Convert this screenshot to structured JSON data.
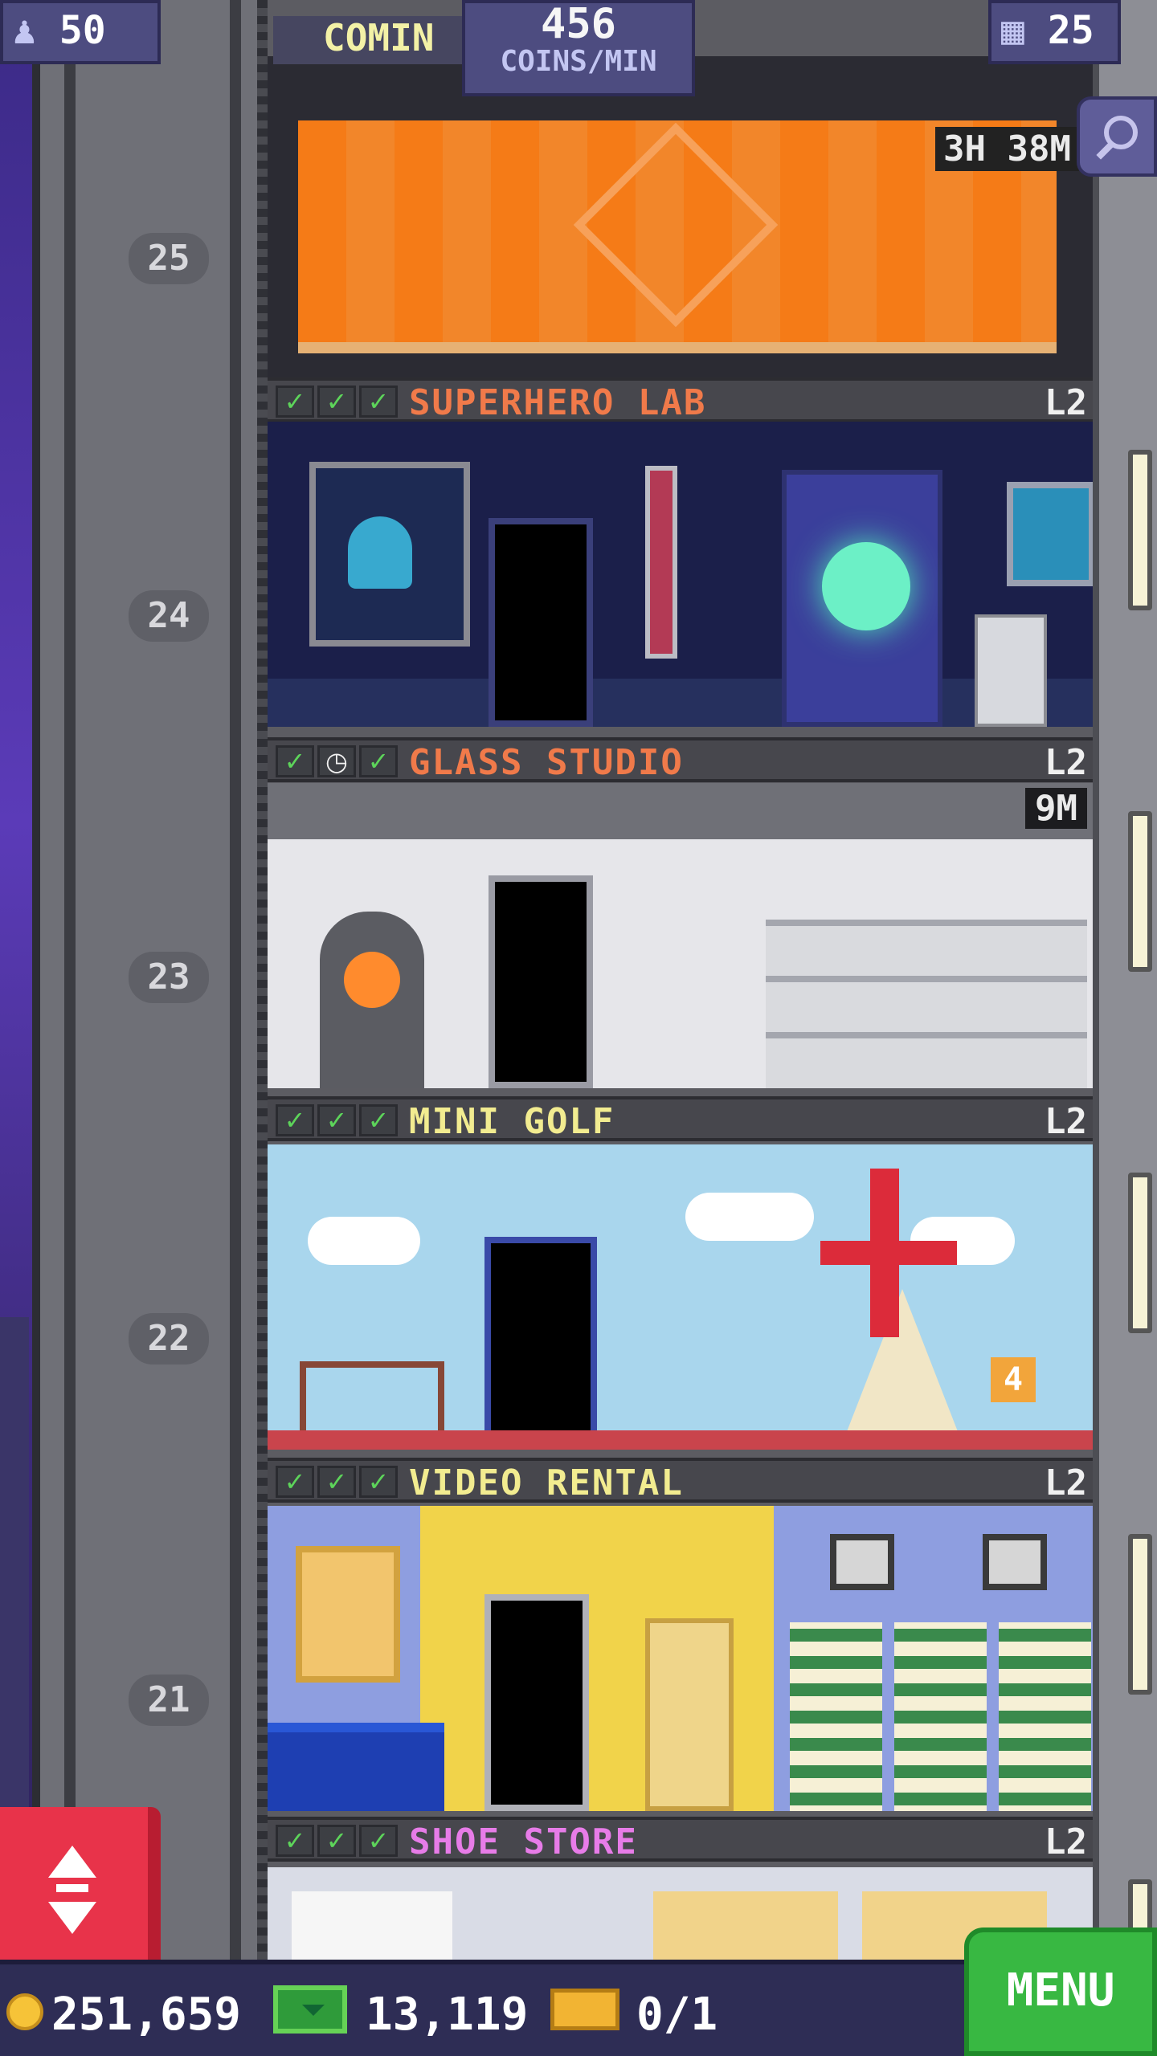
{
  "hud": {
    "population": "50",
    "coins_per_min_value": "456",
    "coins_per_min_unit": "COINS/MIN",
    "floor_count": "25",
    "coming_soon_label": "COMIN"
  },
  "construction": {
    "timer": "3H 38M"
  },
  "floor_numbers": [
    "25",
    "24",
    "23",
    "22",
    "21"
  ],
  "floors": [
    {
      "name": "SUPERHERO LAB",
      "level": "L2",
      "name_color": "#f07a4a",
      "checks": [
        "check",
        "check",
        "check"
      ]
    },
    {
      "name": "GLASS STUDIO",
      "level": "L2",
      "name_color": "#f07a4a",
      "checks": [
        "check",
        "clock",
        "check"
      ],
      "timer": "9M"
    },
    {
      "name": "MINI GOLF",
      "level": "L2",
      "name_color": "#f2ec90",
      "checks": [
        "check",
        "check",
        "check"
      ]
    },
    {
      "name": "VIDEO RENTAL",
      "level": "L2",
      "name_color": "#f2ec90",
      "checks": [
        "check",
        "check",
        "check"
      ]
    },
    {
      "name": "SHOE STORE",
      "level": "L2",
      "name_color": "#e77ce8",
      "checks": [
        "check",
        "check",
        "check"
      ]
    }
  ],
  "golf_hole_number": "4",
  "bottom": {
    "coins": "251,659",
    "bux": "13,119",
    "tickets": "0/1",
    "menu_label": "MENU"
  },
  "icons": {
    "population": "person-icon",
    "floors": "building-icon",
    "zoom": "zoom-out-icon",
    "elevator": "elevator-arrows-icon",
    "coins": "coin-icon",
    "bux": "tower-bux-icon",
    "tickets": "golden-ticket-icon"
  }
}
